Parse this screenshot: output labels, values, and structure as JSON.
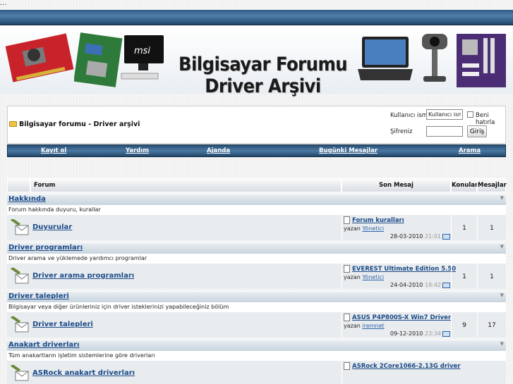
{
  "top": {
    "dots": "..."
  },
  "banner": {
    "title_line1": "Bilgisayar Forumu",
    "title_line2": "Driver Arşivi"
  },
  "login": {
    "breadcrumb": "Bilgisayar forumu - Driver arşivi",
    "username_label": "Kullanıcı ismi",
    "username_value": "Kullanıcı ismi",
    "remember_label": "Beni hatırla",
    "password_label": "Şifreniz",
    "submit_label": "Giriş"
  },
  "nav": [
    {
      "label": "Kayıt ol"
    },
    {
      "label": "Yardım"
    },
    {
      "label": "Ajanda"
    },
    {
      "label": "Bugünki Mesajlar"
    },
    {
      "label": "Arama"
    }
  ],
  "table": {
    "headers": {
      "forum": "Forum",
      "last_post": "Son Mesaj",
      "threads": "Konular",
      "posts": "Mesajlar"
    },
    "by_label": "yazan",
    "sections": [
      {
        "category": "Hakkında",
        "description": "Forum hakkında duyuru, kurallar",
        "forum": "Duyurular",
        "last_title": "Forum kuralları",
        "last_user": "Yönetici",
        "last_date": "28-03-2010",
        "last_time": "21:01",
        "threads": "1",
        "posts": "1"
      },
      {
        "category": "Driver programları",
        "description": "Driver arama ve yüklemede yardımcı programlar",
        "forum": "Driver arama programları",
        "last_title": "EVEREST Ultimate Edition 5.50",
        "last_user": "Yönetici",
        "last_date": "24-04-2010",
        "last_time": "18:42",
        "threads": "1",
        "posts": "1"
      },
      {
        "category": "Driver talepleri",
        "description": "Bilgisayar veya diğer ürünleriniz için driver isteklerinizi yapabileceğiniz bölüm",
        "forum": "Driver talepleri",
        "last_title": "ASUS P4P800S-X Win7 Driver",
        "last_user": "iremnet",
        "last_date": "09-12-2010",
        "last_time": "23:34",
        "threads": "9",
        "posts": "17"
      },
      {
        "category": "Anakart driverları",
        "description": "Tüm anakartların işletim sistemlerine göre driverları",
        "forum": "ASRock anakart driverları",
        "last_title": "ASRock 2Core1066-2.13G driver"
      }
    ]
  }
}
